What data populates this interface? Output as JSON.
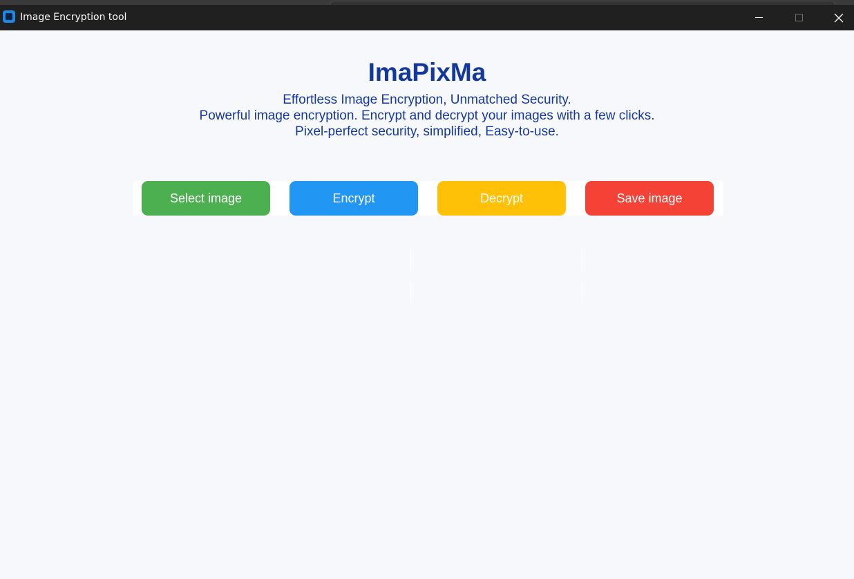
{
  "window": {
    "title": "Image Encryption tool",
    "icon": "app-icon"
  },
  "header": {
    "app_name": "ImaPixMa",
    "taglines": [
      "Effortless Image Encryption, Unmatched Security.",
      "Powerful image encryption. Encrypt and decrypt your images with a few clicks.",
      "Pixel-perfect security, simplified, Easy-to-use."
    ]
  },
  "buttons": [
    {
      "label": "Select image",
      "color": "#4caf50"
    },
    {
      "label": "Encrypt",
      "color": "#2196f3"
    },
    {
      "label": "Decrypt",
      "color": "#ffc107"
    },
    {
      "label": "Save image",
      "color": "#f44336"
    }
  ],
  "colors": {
    "accent_text": "#15389b",
    "background": "#f7f8fc",
    "titlebar": "#202020"
  }
}
